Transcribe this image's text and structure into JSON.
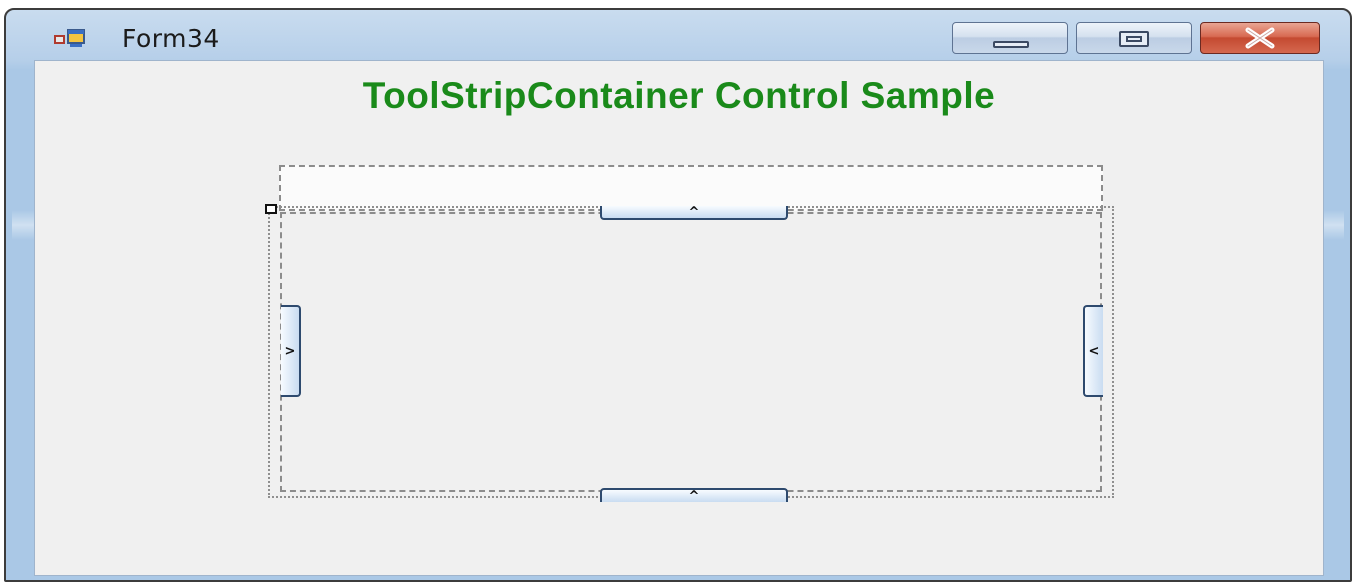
{
  "window": {
    "title": "Form34",
    "app_icon": "form-app-icon",
    "buttons": {
      "minimize_icon": "minimize-icon",
      "maximize_icon": "maximize-icon",
      "close_icon": "close-icon"
    },
    "colors": {
      "frame": "#aac8e6",
      "close_button": "#c44a31",
      "client_background": "#f0f0f0"
    }
  },
  "form": {
    "heading": "ToolStripContainer Control Sample",
    "heading_color": "#1a8a1a"
  },
  "toolstrip_container": {
    "top_panel_expand_glyph": "^",
    "bottom_panel_expand_glyph": "^",
    "left_panel_expand_glyph": ">",
    "right_panel_expand_glyph": "<"
  }
}
